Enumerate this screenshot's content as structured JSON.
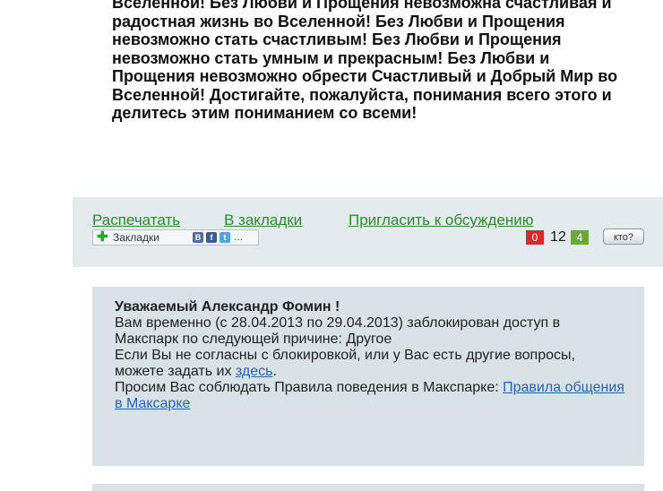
{
  "post": {
    "paragraph": "Вселенной! Без Любви и Прощения невозможна счастливая и радостная жизнь во Вселенной! Без Любви и Прощения невозможно стать счастливым! Без Любви и Прощения невозможно стать умным и прекрасным! Без Любви и Прощения невозможно обрести Счастливый и Добрый Мир во Вселенной! Достигайте, пожалуйста, понимания всего этого и делитесь этим пониманием со всеми!"
  },
  "actions": {
    "print": "Распечатать",
    "bookmarks": "В закладки",
    "invite": "Пригласить к обсуждению"
  },
  "bookmark_widget": {
    "label": "Закладки",
    "more": "..."
  },
  "counters": {
    "negative": "0",
    "total": "12",
    "positive": "4",
    "who_label": "кто?"
  },
  "colors": {
    "link_green": "#2e8b2e",
    "link_blue": "#2a63b0",
    "negative_red": "#d42b2b",
    "positive_green": "#6aaa32"
  },
  "notice": {
    "title": "Уважаемый Александр Фомин !",
    "line1": "Вам временно (с 28.04.2013 по 29.04.2013) заблокирован доступ в Макспарк по следующей причине:  Другое",
    "line2_prefix": "Если Вы не согласны с блокировкой, или у Вас есть другие вопросы, можете задать их ",
    "here_link": "здесь",
    "line2_suffix": ".",
    "line3_prefix": "Просим Вас соблюдать Правила поведения в Макспарке: ",
    "rules_link": "Правила общения в Максарке"
  }
}
